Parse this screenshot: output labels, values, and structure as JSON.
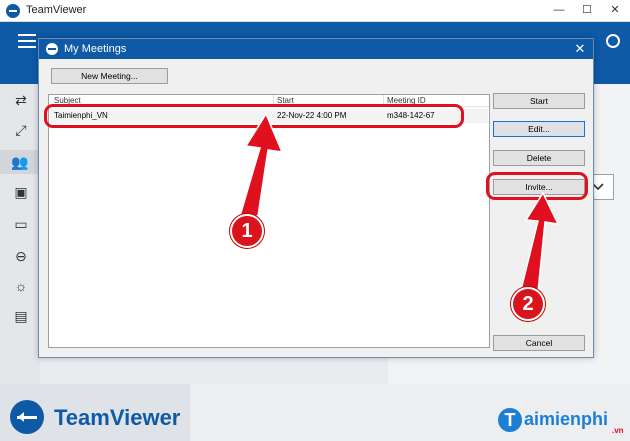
{
  "app": {
    "window_title": "TeamViewer",
    "window_controls": [
      "—",
      "☐",
      "✕"
    ],
    "logo_text": "TeamViewer",
    "sidebar_icons": [
      "remote-control-icon",
      "fullscreen-icon",
      "meetings-icon",
      "contacts-icon",
      "chat-icon",
      "vr-headset-icon",
      "lightbulb-icon",
      "gift-icon"
    ],
    "accent_color": "#0e5aa7"
  },
  "dialog": {
    "title": "My Meetings",
    "close": "✕",
    "new_meeting_label": "New Meeting...",
    "columns": [
      "Subject",
      "Start",
      "Meeting ID"
    ],
    "rows": [
      {
        "subject": "Taimienphi_VN",
        "start": "22-Nov-22 4:00 PM",
        "meeting_id": "m348-142-67"
      }
    ],
    "buttons": {
      "start": "Start",
      "edit": "Edit...",
      "delete": "Delete",
      "invite": "Invite...",
      "cancel": "Cancel"
    }
  },
  "annotations": {
    "step1": "1",
    "step2": "2",
    "highlight_color": "#e0101e"
  },
  "watermark": {
    "icon_letter": "T",
    "text": "aimienphi",
    "tld": ".vn"
  }
}
